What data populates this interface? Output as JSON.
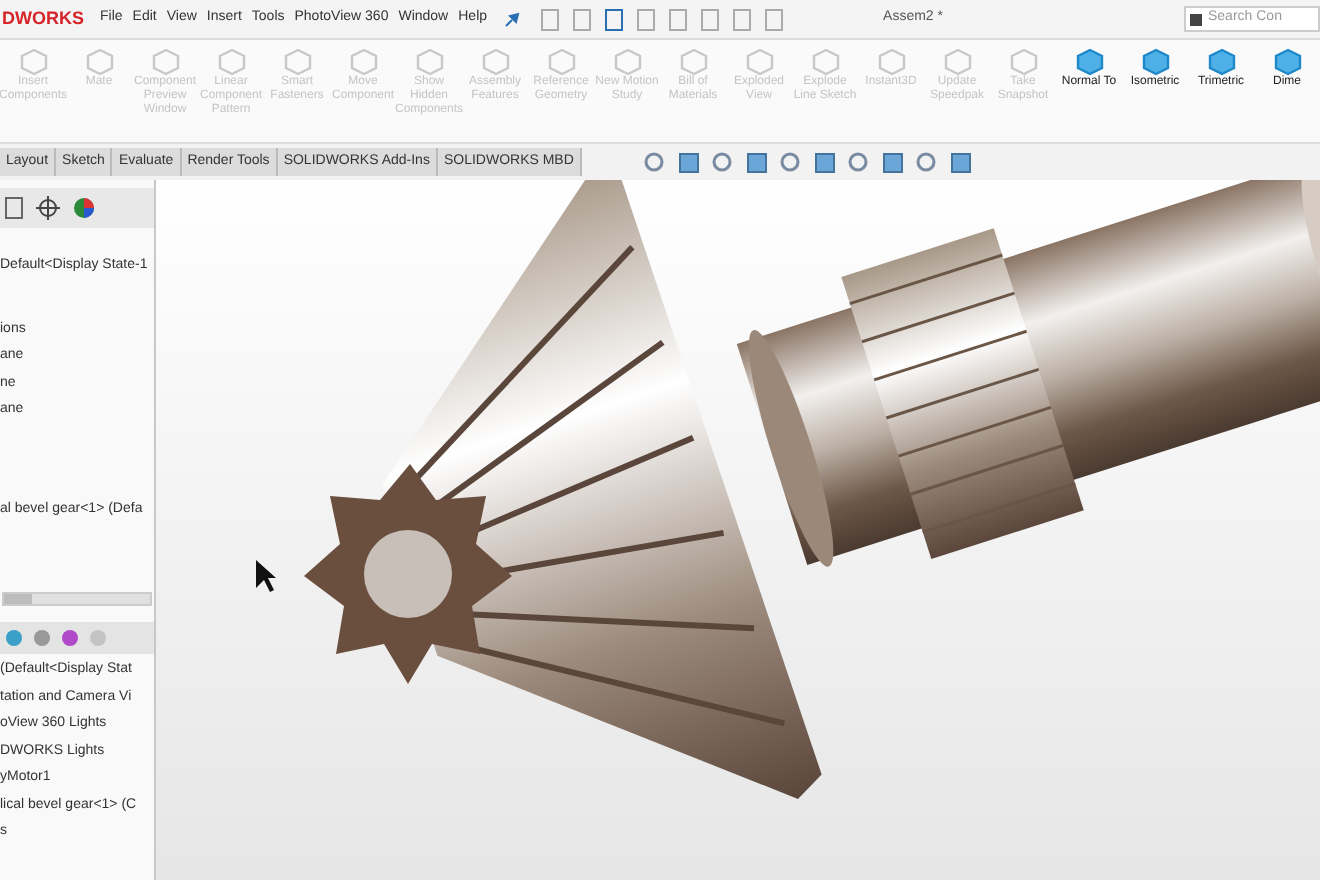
{
  "titlebar": {
    "logo": "DWORKS",
    "menu": [
      "File",
      "Edit",
      "View",
      "Insert",
      "Tools",
      "PhotoView 360",
      "Window",
      "Help"
    ],
    "document_title": "Assem2 *",
    "search": {
      "placeholder": "Search Con"
    }
  },
  "ribbon": [
    {
      "label": "Insert Components",
      "disabled": true
    },
    {
      "label": "Mate",
      "disabled": true
    },
    {
      "label": "Component Preview Window",
      "disabled": true
    },
    {
      "label": "Linear Component Pattern",
      "disabled": true
    },
    {
      "label": "Smart Fasteners",
      "disabled": true
    },
    {
      "label": "Move Component",
      "disabled": true
    },
    {
      "label": "Show Hidden Components",
      "disabled": true
    },
    {
      "label": "Assembly Features",
      "disabled": true
    },
    {
      "label": "Reference Geometry",
      "disabled": true
    },
    {
      "label": "New Motion Study",
      "disabled": true
    },
    {
      "label": "Bill of Materials",
      "disabled": true
    },
    {
      "label": "Exploded View",
      "disabled": true
    },
    {
      "label": "Explode Line Sketch",
      "disabled": true
    },
    {
      "label": "Instant3D",
      "disabled": true
    },
    {
      "label": "Update Speedpak",
      "disabled": true
    },
    {
      "label": "Take Snapshot",
      "disabled": true
    },
    {
      "label": "Normal To",
      "disabled": false
    },
    {
      "label": "Isometric",
      "disabled": false
    },
    {
      "label": "Trimetric",
      "disabled": false
    },
    {
      "label": "Dime",
      "disabled": false
    }
  ],
  "tabs": [
    {
      "label": "Layout",
      "selected": false
    },
    {
      "label": "Sketch",
      "selected": false
    },
    {
      "label": "Evaluate",
      "selected": false
    },
    {
      "label": "Render Tools",
      "selected": false
    },
    {
      "label": "SOLIDWORKS Add-Ins",
      "selected": false
    },
    {
      "label": "SOLIDWORKS MBD",
      "selected": false
    }
  ],
  "feature_tree": [
    "Default<Display State-1",
    "ions",
    "ane",
    "ne",
    "ane",
    "al bevel gear<1> (Defa"
  ],
  "display_manager": [
    "(Default<Display Stat",
    "tation and Camera Vi",
    "oView 360 Lights",
    "DWORKS Lights",
    "yMotor1",
    "lical bevel gear<1> (C",
    "s"
  ]
}
